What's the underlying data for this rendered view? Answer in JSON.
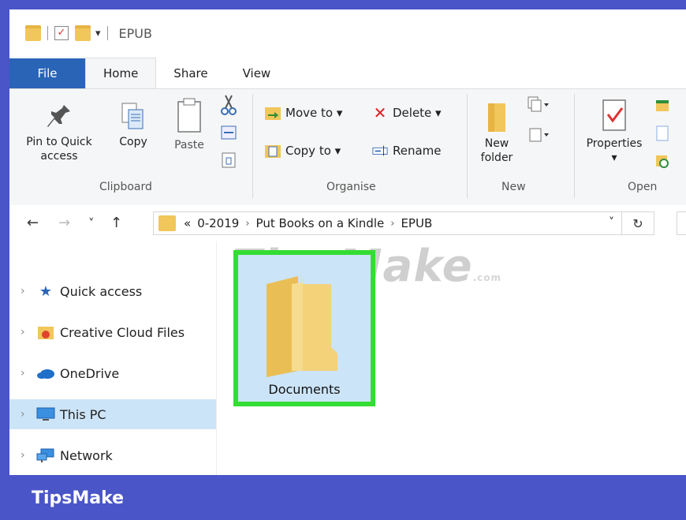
{
  "titlebar": {
    "title": "EPUB",
    "quick_access_down": "▾"
  },
  "tabs": [
    {
      "label": "File"
    },
    {
      "label": "Home"
    },
    {
      "label": "Share"
    },
    {
      "label": "View"
    }
  ],
  "ribbon": {
    "pin_label": "Pin to Quick\naccess",
    "copy_label": "Copy",
    "paste_label": "Paste",
    "move_to": "Move to ▾",
    "copy_to": "Copy to ▾",
    "delete": "Delete ▾",
    "rename": "Rename",
    "new_folder": "New\nfolder",
    "properties": "Properties",
    "properties_drop": "▾",
    "groups": [
      "Clipboard",
      "Organise",
      "New",
      "Open"
    ]
  },
  "address": {
    "back": "←",
    "forward": "→",
    "recent": "˅",
    "up": "↑",
    "overflow": "«",
    "crumbs": [
      "0-2019",
      "Put Books on a Kindle",
      "EPUB"
    ],
    "crumb_sep": "›",
    "dropdown": "˅",
    "refresh": "↻"
  },
  "nav": {
    "items": [
      {
        "label": "Quick access",
        "icon": "star-icon"
      },
      {
        "label": "Creative Cloud Files",
        "icon": "creative-cloud-icon"
      },
      {
        "label": "OneDrive",
        "icon": "cloud-icon"
      },
      {
        "label": "This PC",
        "icon": "computer-icon"
      },
      {
        "label": "Network",
        "icon": "network-icon"
      }
    ],
    "chevron": "›"
  },
  "content": {
    "folder_label": "Documents",
    "watermark": "TipsMake",
    "watermark_suffix": ".com"
  },
  "brand": "TipsMake",
  "colors": {
    "frame": "#4a55c8",
    "file_tab": "#2a64b6",
    "highlight": "#33dd33",
    "selected": "#cce4f7",
    "folder": "#f1c65a"
  }
}
